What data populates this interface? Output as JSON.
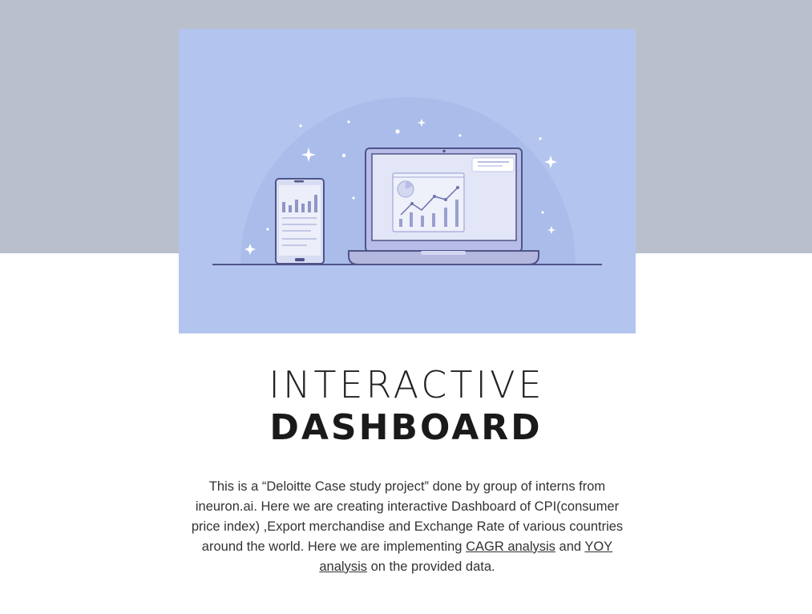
{
  "hero": {
    "illustration": "laptop-and-phone-dashboard-illustration"
  },
  "title": {
    "line1": "INTERACTIVE",
    "line2": "DASHBOARD"
  },
  "description": {
    "text_before": "This is a “Deloitte Case study project” done by group of interns from ineuron.ai. Here we are creating interactive Dashboard of CPI(consumer price index) ,Export merchandise and Exchange Rate of various countries around the world. Here we are implementing ",
    "link1": "CAGR analysis",
    "text_middle": " and ",
    "link2": "YOY analysis",
    "text_after": " on the provided data."
  },
  "colors": {
    "top_band": "#b9c0cb",
    "hero_background": "#b3c4ef",
    "device_outline": "#4e5488",
    "screen_fill": "#e3e6f7"
  }
}
